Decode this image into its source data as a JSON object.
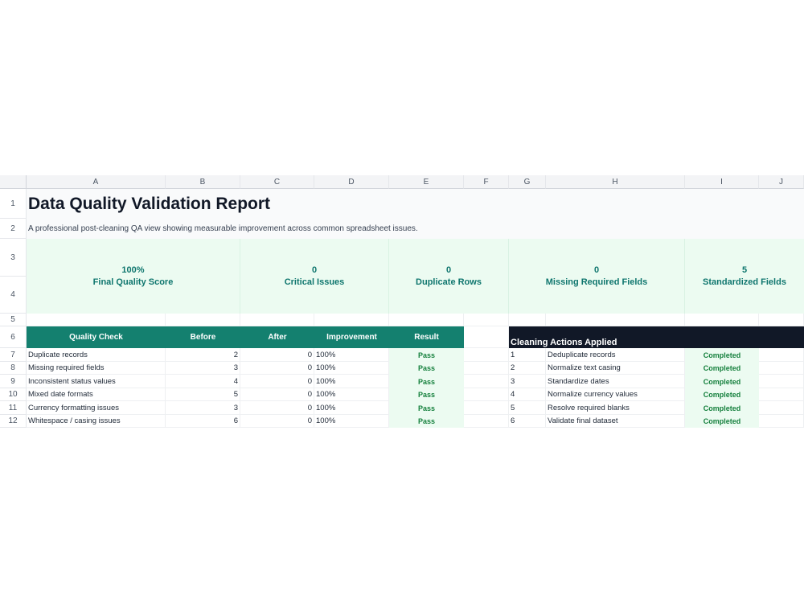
{
  "columns": [
    "A",
    "B",
    "C",
    "D",
    "E",
    "F",
    "G",
    "H",
    "I",
    "J"
  ],
  "rows": [
    "1",
    "2",
    "3",
    "4",
    "5",
    "6",
    "7",
    "8",
    "9",
    "10",
    "11",
    "12"
  ],
  "title": "Data Quality Validation Report",
  "subtitle": "A professional post-cleaning QA view showing measurable improvement across common spreadsheet issues.",
  "kpis": [
    {
      "value": "100%",
      "label": "Final Quality Score"
    },
    {
      "value": "0",
      "label": "Critical Issues"
    },
    {
      "value": "0",
      "label": "Duplicate Rows"
    },
    {
      "value": "0",
      "label": "Missing Required Fields"
    },
    {
      "value": "5",
      "label": "Standardized Fields"
    }
  ],
  "quality_table": {
    "headers": [
      "Quality Check",
      "Before",
      "After",
      "Improvement",
      "Result"
    ],
    "rows": [
      {
        "check": "Duplicate records",
        "before": "2",
        "after": "0",
        "improvement": "100%",
        "result": "Pass"
      },
      {
        "check": "Missing required fields",
        "before": "3",
        "after": "0",
        "improvement": "100%",
        "result": "Pass"
      },
      {
        "check": "Inconsistent status values",
        "before": "4",
        "after": "0",
        "improvement": "100%",
        "result": "Pass"
      },
      {
        "check": "Mixed date formats",
        "before": "5",
        "after": "0",
        "improvement": "100%",
        "result": "Pass"
      },
      {
        "check": "Currency formatting issues",
        "before": "3",
        "after": "0",
        "improvement": "100%",
        "result": "Pass"
      },
      {
        "check": "Whitespace / casing issues",
        "before": "6",
        "after": "0",
        "improvement": "100%",
        "result": "Pass"
      }
    ]
  },
  "actions_table": {
    "header": "Cleaning Actions Applied",
    "rows": [
      {
        "num": "1",
        "action": "Deduplicate records",
        "status": "Completed"
      },
      {
        "num": "2",
        "action": "Normalize text casing",
        "status": "Completed"
      },
      {
        "num": "3",
        "action": "Standardize dates",
        "status": "Completed"
      },
      {
        "num": "4",
        "action": "Normalize currency values",
        "status": "Completed"
      },
      {
        "num": "5",
        "action": "Resolve required blanks",
        "status": "Completed"
      },
      {
        "num": "6",
        "action": "Validate final dataset",
        "status": "Completed"
      }
    ]
  },
  "colors": {
    "accent": "#14806f",
    "kpi_bg": "#ecfbf1",
    "dark_header": "#111827",
    "pass_text": "#15803d"
  }
}
